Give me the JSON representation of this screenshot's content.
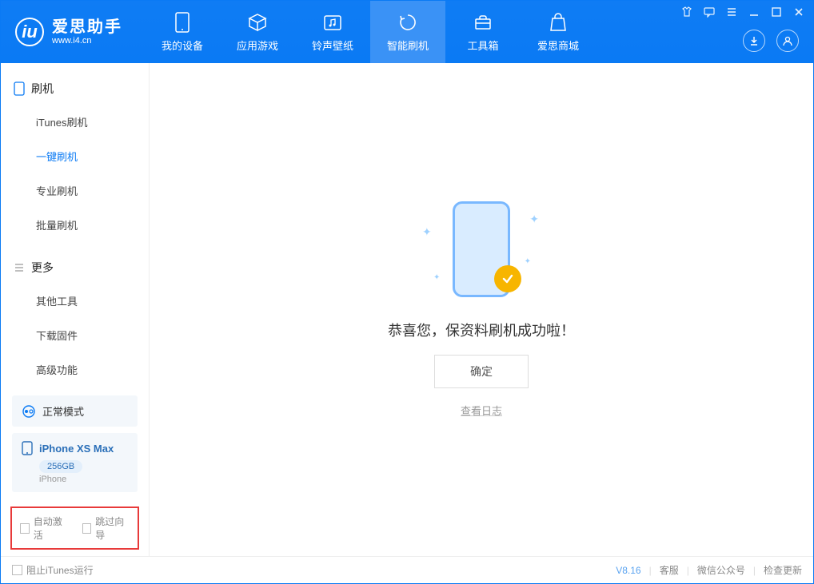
{
  "app": {
    "name": "爱思助手",
    "site": "www.i4.cn"
  },
  "nav": {
    "device": "我的设备",
    "apps": "应用游戏",
    "ring": "铃声壁纸",
    "flash": "智能刷机",
    "tools": "工具箱",
    "store": "爱思商城"
  },
  "sidebar": {
    "flash_header": "刷机",
    "items": {
      "itunes": "iTunes刷机",
      "oneclick": "一键刷机",
      "pro": "专业刷机",
      "batch": "批量刷机"
    },
    "more_header": "更多",
    "more": {
      "other": "其他工具",
      "firmware": "下载固件",
      "advanced": "高级功能"
    }
  },
  "mode": {
    "label": "正常模式"
  },
  "device": {
    "name": "iPhone XS Max",
    "storage": "256GB",
    "type": "iPhone"
  },
  "checks": {
    "auto_activate": "自动激活",
    "skip_guide": "跳过向导"
  },
  "main": {
    "success_msg": "恭喜您，保资料刷机成功啦！",
    "ok": "确定",
    "view_log": "查看日志"
  },
  "footer": {
    "block_itunes": "阻止iTunes运行",
    "version": "V8.16",
    "support": "客服",
    "wechat": "微信公众号",
    "update": "检查更新"
  }
}
